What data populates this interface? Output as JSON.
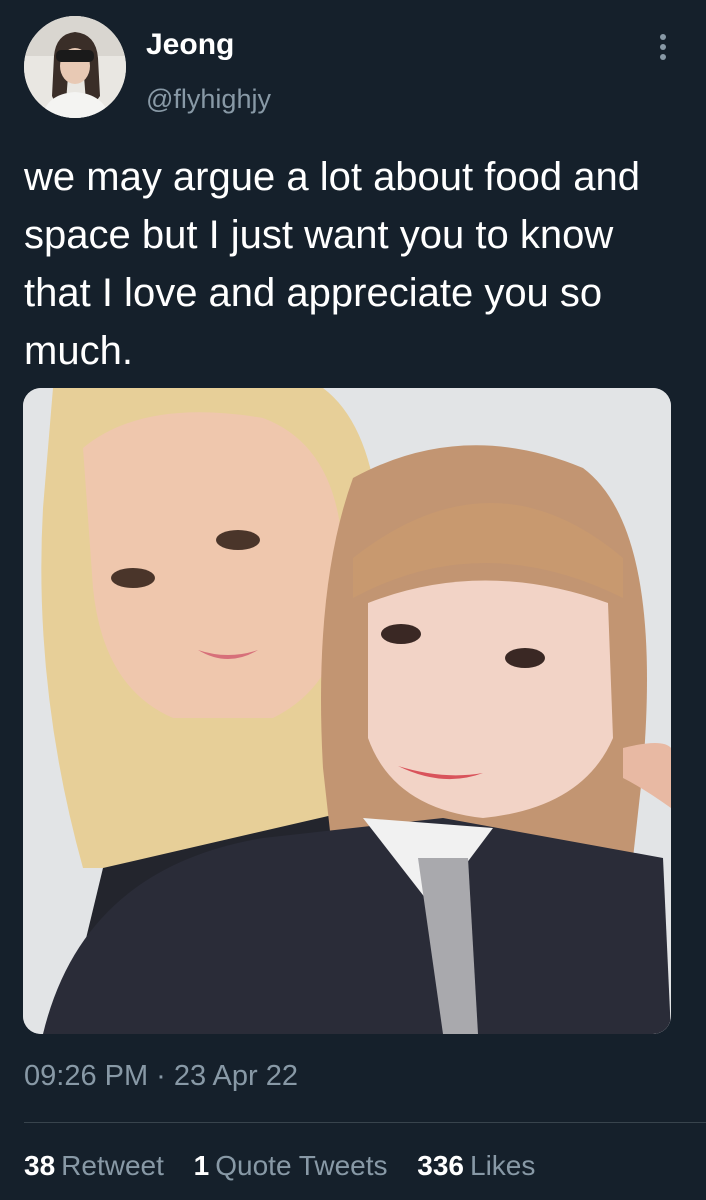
{
  "author": {
    "name": "Jeong",
    "handle": "@flyhighjy"
  },
  "tweet": {
    "text": "we may argue a lot about food and space but I just want you to know that I love and appreciate you so much.",
    "time": "09:26 PM",
    "separator": "·",
    "date": "23 Apr 22"
  },
  "stats": {
    "retweets": {
      "count": "38",
      "label": "Retweet"
    },
    "quotes": {
      "count": "1",
      "label": "Quote Tweets"
    },
    "likes": {
      "count": "336",
      "label": "Likes"
    }
  },
  "icons": {
    "more": "more-vertical-icon"
  },
  "colors": {
    "background": "#15202b",
    "text_primary": "#ffffff",
    "text_secondary": "#8899a6",
    "divider": "#38444d"
  }
}
